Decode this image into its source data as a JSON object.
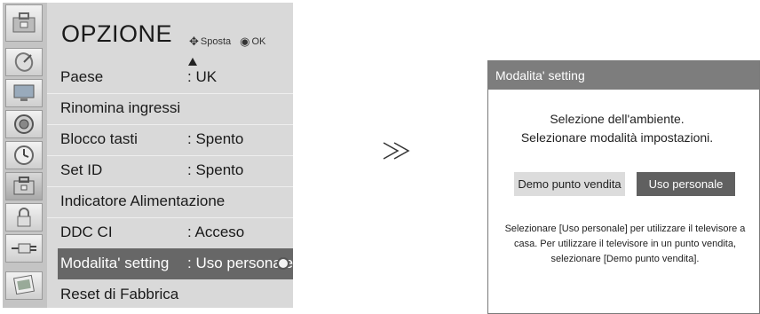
{
  "menu": {
    "title": "OPZIONE",
    "hint_move": "Sposta",
    "hint_ok": "OK",
    "items": [
      {
        "label": "Paese",
        "value": ": UK"
      },
      {
        "label": "Rinomina ingressi",
        "value": ""
      },
      {
        "label": "Blocco tasti",
        "value": ": Spento"
      },
      {
        "label": "Set ID",
        "value": ": Spento"
      },
      {
        "label": "Indicatore Alimentazione",
        "value": ""
      },
      {
        "label": "DDC CI",
        "value": ": Acceso"
      },
      {
        "label": "Modalita' setting",
        "value": ": Uso personale",
        "selected": true
      },
      {
        "label": "Reset di Fabbrica",
        "value": ""
      }
    ],
    "side_icons": [
      "option-menu-icon",
      "satellite-dish-icon",
      "monitor-icon",
      "speaker-icon",
      "clock-icon",
      "option-icon",
      "lock-icon",
      "input-plug-icon",
      "photo-icon"
    ]
  },
  "arrow_glyph": "≫",
  "dialog": {
    "title": "Modalita' setting",
    "message_line1": "Selezione dell'ambiente.",
    "message_line2": "Selezionare modalità impostazioni.",
    "button_demo": "Demo punto vendita",
    "button_personal": "Uso personale",
    "description": "Selezionare [Uso personale] per utilizzare il televisore a casa. Per utilizzare il televisore in un punto vendita, selezionare [Demo punto vendita]."
  }
}
